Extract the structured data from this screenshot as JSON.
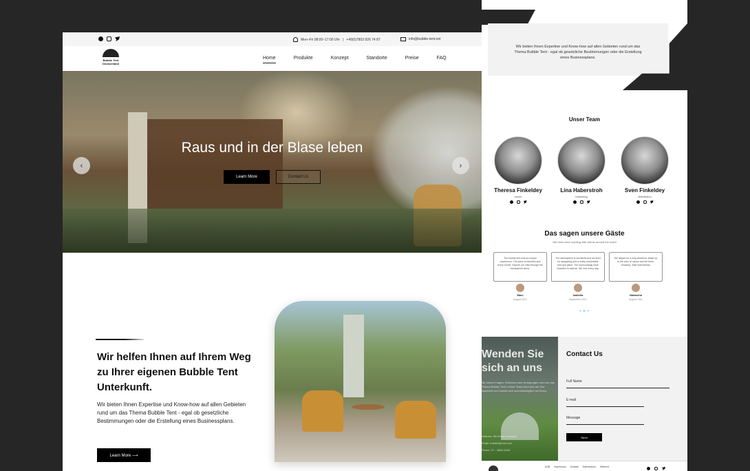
{
  "topbar": {
    "hours": "Mon–Fri 08:00–17:00 Uhr",
    "phone": "+49(0)7803 926 74 87",
    "email": "info@bubble-tent.net"
  },
  "logo": {
    "line1": "Bubble Tent",
    "line2": "Deutschland"
  },
  "nav": {
    "items": [
      "Home",
      "Produkte",
      "Konzept",
      "Standorte",
      "Preise",
      "FAQ"
    ],
    "active": "Home"
  },
  "hero": {
    "title": "Raus und in der Blase leben",
    "primary_button": "Learn More",
    "secondary_button": "Contact Us",
    "prev_arrow": "‹",
    "next_arrow": "›"
  },
  "about": {
    "heading": "Wir helfen Ihnen auf Ihrem Weg zu Ihrer eigenen Bubble Tent Unterkunft.",
    "text": "Wir bieten Ihnen Expertise und Know-how auf allen Gebieten rund um das Thema Bubble Tent - egal ob gesetzliche Bestimmungen oder die Erstellung eines Businessplans.",
    "button": "Learn More ⟶"
  },
  "right_intro": {
    "text": "Wir bieten Ihnen Expertise und Know-how auf allen Gebieten rund um das Thema Bubble Tent - egal ob gesetzliche Bestimmungen oder die Erstellung eines Businessplans."
  },
  "team": {
    "title": "Unser Team",
    "members": [
      {
        "name": "Theresa Finkeldey",
        "role": "owner"
      },
      {
        "name": "Lina Haberstroh",
        "role": "marketing"
      },
      {
        "name": "Sven Finkeldey",
        "role": "distribution"
      }
    ]
  },
  "reviews": {
    "title": "Das sagen unsere Gäste",
    "subtitle": "We have been working with clients around the world",
    "items": [
      {
        "text": "The bubble tent was an unique experience. The place is beautiful and every corner. Explore our view through the transparent dome.",
        "name": "Marc",
        "date": "August 2021"
      },
      {
        "text": "The atmosphere is wonderful and we lived for stargazing and a really comfortable bed and place. The surroundings were beautiful to explore. We love every day.",
        "name": "Isabella",
        "date": "September 2021"
      },
      {
        "text": "We stayed for a long weekend. Wake up to the view of nature and the birds. Amazing. Staff was friendly.",
        "name": "Natascha",
        "date": "August 1991"
      }
    ],
    "dots": "• o •"
  },
  "contact": {
    "left_title": "Wenden Sie sich an uns",
    "left_text": "Sie haben Fragen, Wünsche oder Anregungen rund um das Thema Bubble Tent? Unser Team freut sich auf Ihre Nachricht und meldet sich schnellstmöglich bei Ihnen.",
    "address": "Address: 5th Road Germany",
    "mail": "Email: bubble@mail.com",
    "phone": "Phone: 07 - 4855-3183",
    "title": "Contact Us",
    "full_name": "Full Name",
    "email_label": "E-mail",
    "message_label": "Message",
    "send": "Send"
  },
  "footer": {
    "links": [
      "AGB",
      "Impressum",
      "Kontakt",
      "Datenschutz",
      "Widerruf"
    ]
  }
}
